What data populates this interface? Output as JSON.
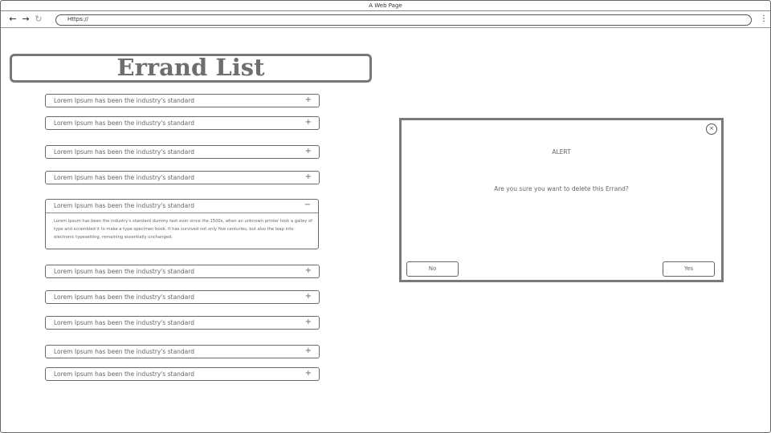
{
  "browser": {
    "window_title": "A Web Page",
    "url": "Https://"
  },
  "page": {
    "title": "Errand List"
  },
  "accordion": {
    "items": [
      {
        "label": "Lorem Ipsum has been the industry's standard",
        "toggle": "+"
      },
      {
        "label": "Lorem Ipsum has been the industry's standard",
        "toggle": "+"
      },
      {
        "label": "Lorem Ipsum has been the industry's standard",
        "toggle": "+"
      },
      {
        "label": "Lorem Ipsum has been the industry's standard",
        "toggle": "+"
      },
      {
        "label": "Lorem Ipsum has been the industry's standard",
        "toggle": "−",
        "body": "Lorem Ipsum has been the industry's standard dummy text ever since the 1500s, when an unknown printer took a galley of type and scrambled it to make a type specimen book. It has survived not only five centuries, but also the leap into electronic typesetting, remaining essentially unchanged."
      },
      {
        "label": "Lorem Ipsum has been the industry's standard",
        "toggle": "+"
      },
      {
        "label": "Lorem Ipsum has been the industry's standard",
        "toggle": "+"
      },
      {
        "label": "Lorem Ipsum has been the industry's standard",
        "toggle": "+"
      },
      {
        "label": "Lorem Ipsum has been the industry's standard",
        "toggle": "+"
      },
      {
        "label": "Lorem Ipsum has been the industry's standard",
        "toggle": "+"
      }
    ]
  },
  "dialog": {
    "title": "ALERT",
    "message": "Are you sure you want to delete this Errand?",
    "no_label": "No",
    "yes_label": "Yes",
    "close_glyph": "×"
  },
  "icons": {
    "back": "arrow-left-icon",
    "forward": "arrow-right-icon",
    "reload": "reload-icon",
    "menu": "kebab-menu-icon"
  }
}
